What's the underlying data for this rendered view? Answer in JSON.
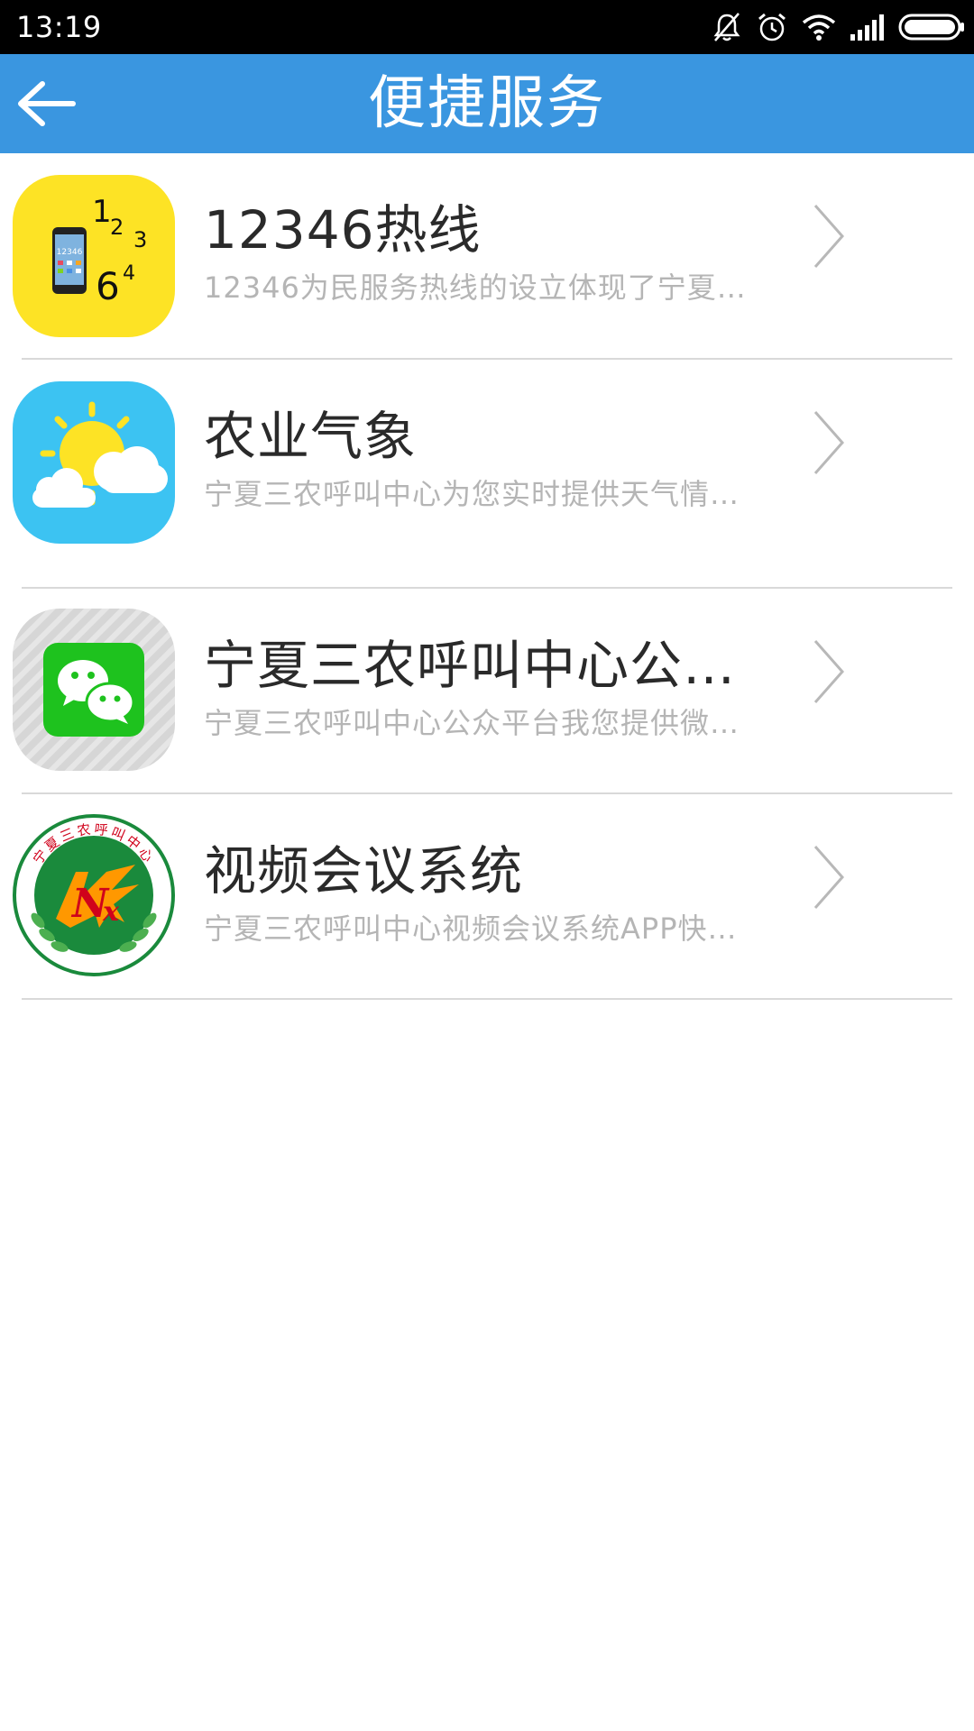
{
  "status_bar": {
    "time": "13:19",
    "icons": [
      "notification-muted-icon",
      "alarm-icon",
      "wifi-icon",
      "signal-icon",
      "battery-icon"
    ]
  },
  "app_bar": {
    "title": "便捷服务",
    "back_icon": "back-arrow-icon",
    "color": "#3a96e0"
  },
  "services": [
    {
      "title": "12346热线",
      "description": "12346为民服务热线的设立体现了宁夏…",
      "icon": "hotline-12346-icon"
    },
    {
      "title": "农业气象",
      "description": "宁夏三农呼叫中心为您实时提供天气情…",
      "icon": "weather-icon"
    },
    {
      "title": "宁夏三农呼叫中心公…",
      "description": "宁夏三农呼叫中心公众平台我您提供微…",
      "icon": "wechat-icon"
    },
    {
      "title": "视频会议系统",
      "description": "宁夏三农呼叫中心视频会议系统APP快…",
      "icon": "nx-call-center-logo-icon",
      "logo_text": "宁夏三农呼叫中心"
    }
  ]
}
